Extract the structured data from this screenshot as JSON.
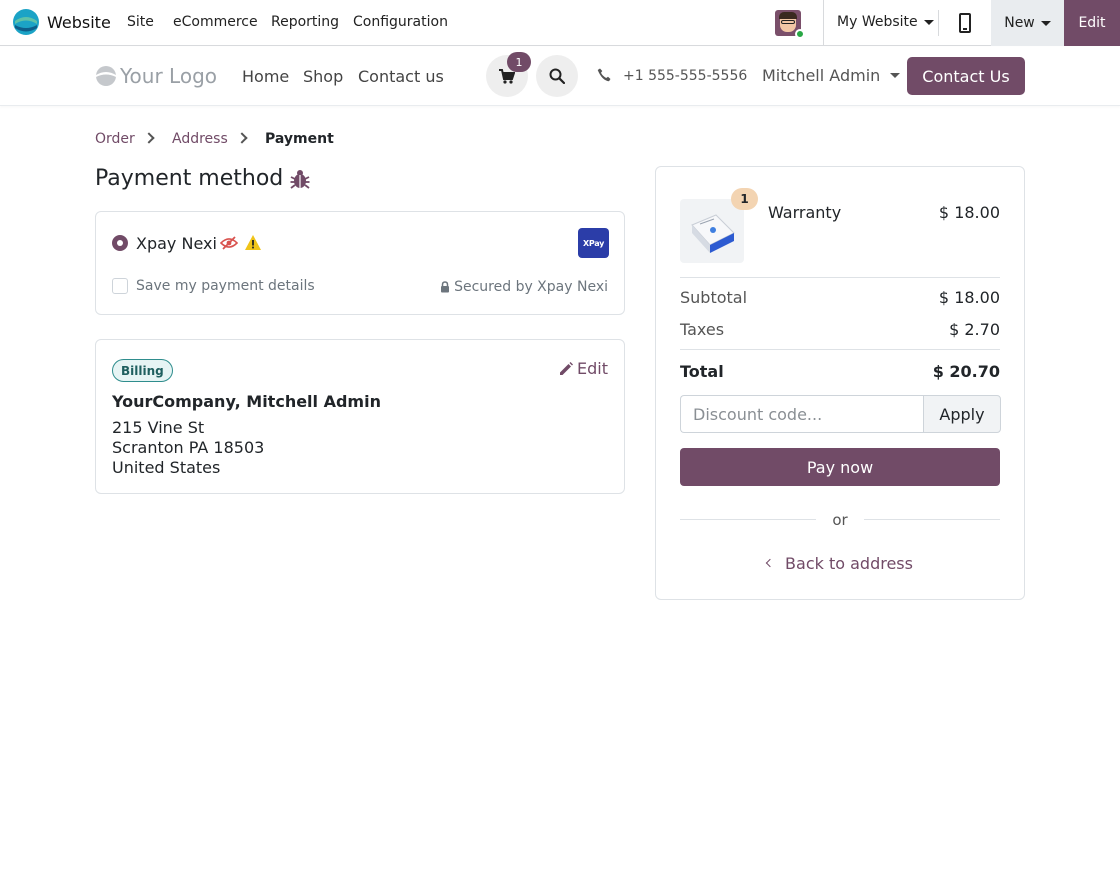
{
  "admin_bar": {
    "app_name": "Website",
    "menu": [
      "Site",
      "eCommerce",
      "Reporting",
      "Configuration"
    ],
    "website_switcher": "My Website",
    "new_label": "New",
    "edit_label": "Edit"
  },
  "site_header": {
    "logo_text": "Your Logo",
    "nav": [
      "Home",
      "Shop",
      "Contact us"
    ],
    "cart_count": "1",
    "phone": "+1 555-555-5556",
    "user": "Mitchell Admin",
    "contact_button": "Contact Us"
  },
  "breadcrumb": [
    "Order",
    "Address",
    "Payment"
  ],
  "payment": {
    "title": "Payment method",
    "method_name": "Xpay Nexi",
    "provider_logo_text": "XPay",
    "save_details_label": "Save my payment details",
    "secured_by": "Secured by Xpay Nexi"
  },
  "billing": {
    "badge": "Billing",
    "edit_label": "Edit",
    "name": "YourCompany, Mitchell Admin",
    "address_lines": [
      "215 Vine St",
      "Scranton PA 18503",
      "United States"
    ]
  },
  "summary": {
    "item": {
      "name": "Warranty",
      "price": "$ 18.00",
      "qty": "1"
    },
    "subtotal_label": "Subtotal",
    "subtotal": "$ 18.00",
    "taxes_label": "Taxes",
    "taxes": "$ 2.70",
    "total_label": "Total",
    "total": "$ 20.70",
    "discount_placeholder": "Discount code...",
    "apply_label": "Apply",
    "pay_label": "Pay now",
    "or_label": "or",
    "back_label": "Back to address"
  },
  "colors": {
    "brand": "#714b67",
    "badge_teal": "#2f8d8d",
    "qty_badge": "#f3d4b2",
    "xpay_blue": "#2b3da8"
  }
}
